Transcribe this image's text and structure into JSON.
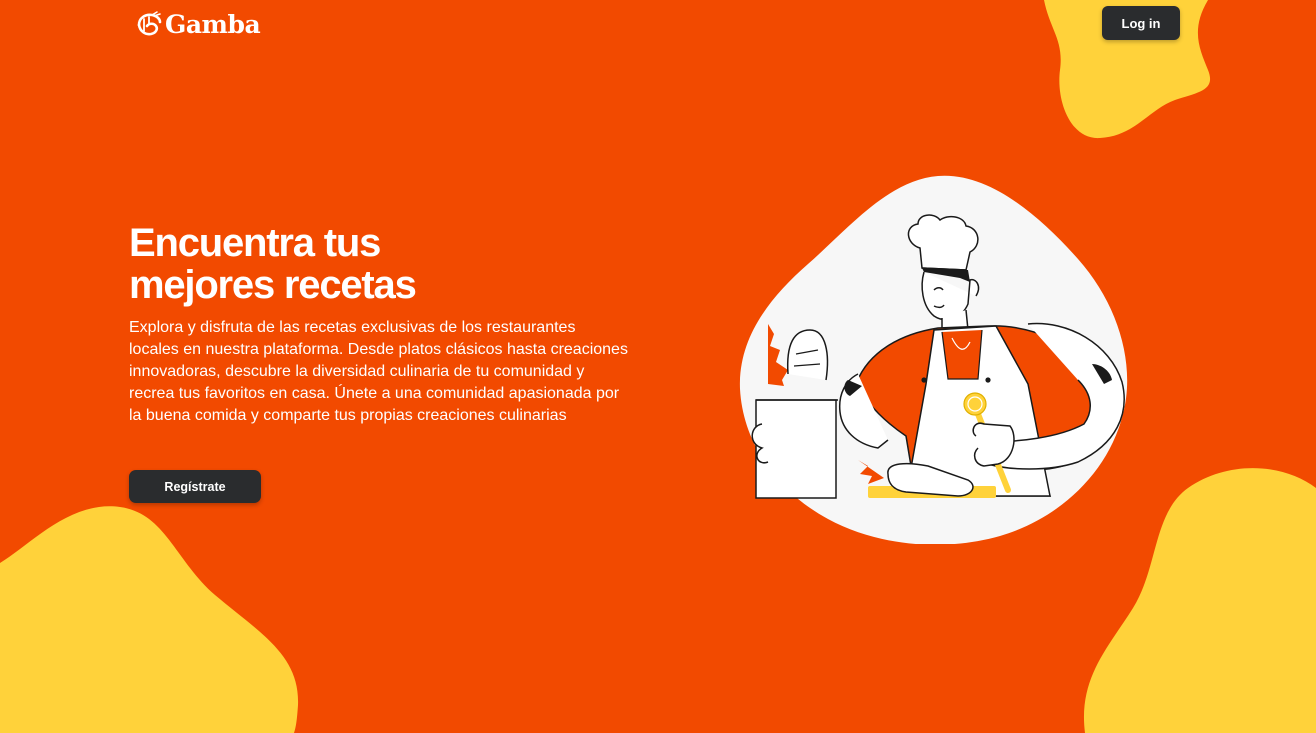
{
  "header": {
    "logo_text": "Gamba",
    "logo_icon": "shrimp-icon",
    "login_label": "Log in"
  },
  "hero": {
    "title_line1": "Encuentra tus",
    "title_line2": "mejores recetas",
    "description": "Explora y disfruta de las recetas exclusivas de los restaurantes locales en nuestra plataforma. Desde platos clásicos hasta creaciones innovadoras, descubre la diversidad culinaria de tu comunidad y recrea tus favoritos en casa. Únete a una comunidad apasionada por la buena comida y comparte tus propias creaciones culinarias",
    "register_label": "Regístrate"
  },
  "illustration": {
    "subject": "chef-with-bread-illustration"
  },
  "colors": {
    "background": "#F24A00",
    "accent_yellow": "#FFD23A",
    "button_dark": "#2A2C2E",
    "text": "#FFFFFF",
    "blob_white": "#F7F7F7"
  }
}
